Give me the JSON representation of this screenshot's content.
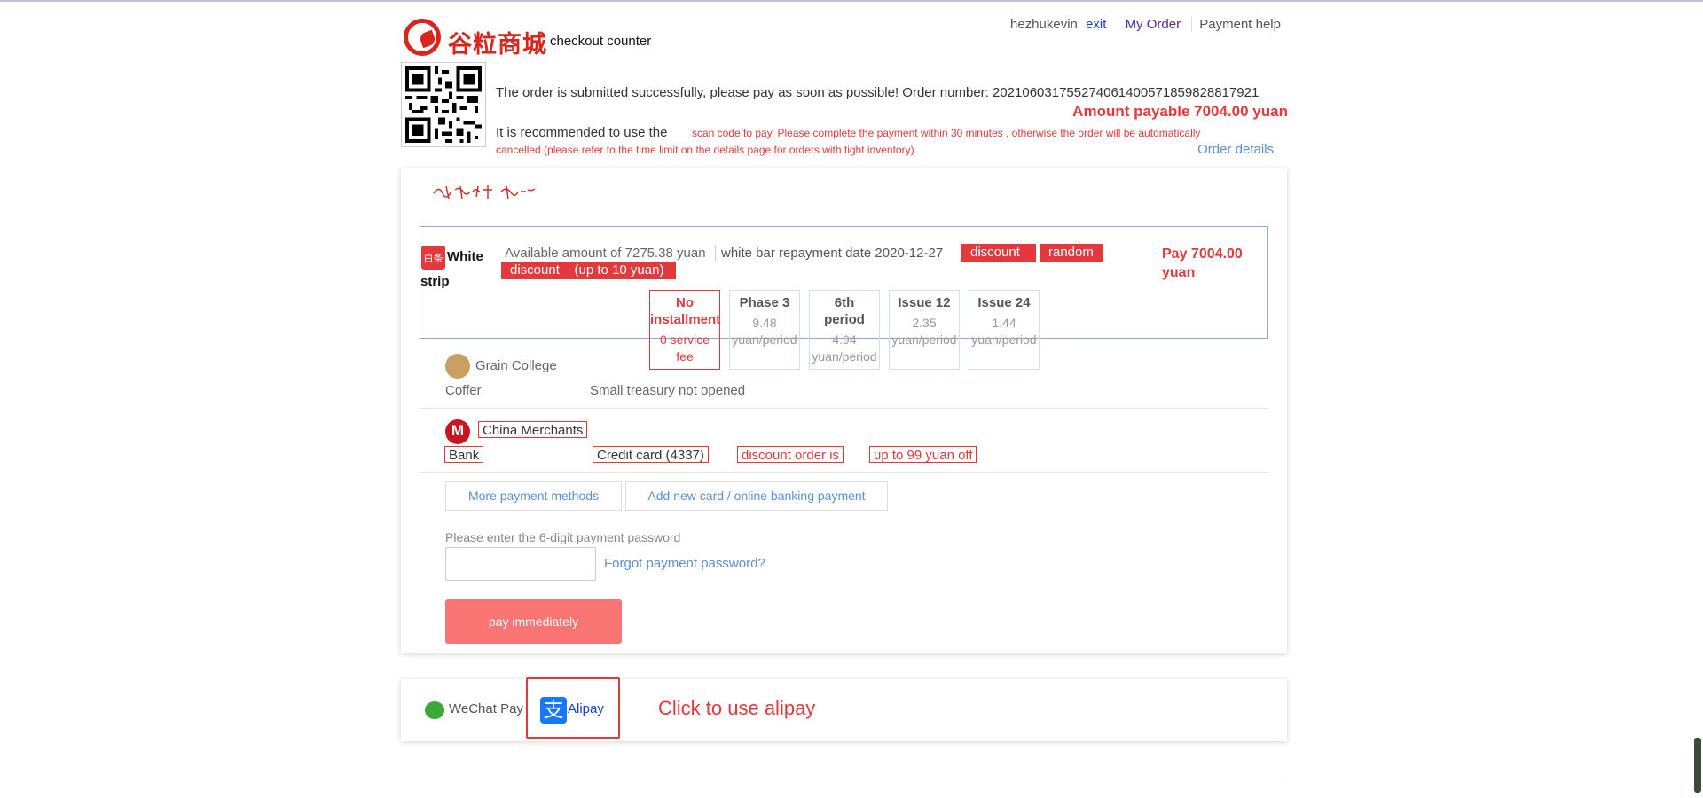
{
  "header": {
    "logo_cn": "谷粒商城",
    "logo_sub": "checkout counter",
    "username": "hezhukevin",
    "exit": "exit",
    "my_order": "My Order",
    "payment_help": "Payment help"
  },
  "order": {
    "submitted_text": "The order is submitted successfully, please pay as soon as possible! Order number: 202106031755274061400571859828817921",
    "amount_payable": "Amount payable 7004.00 yuan",
    "recommend_text": "It is recommended to use the",
    "scan_notice_1": "scan code to pay. Please complete the payment within 30 minutes , otherwise the order will be automatically",
    "scan_notice_2": "cancelled (please refer to the time limit on the details page for orders with tight inventory)",
    "order_details": "Order details"
  },
  "white_strip": {
    "icon_text": "白条",
    "label_1": "White",
    "label_2": "strip",
    "available": "Available amount of 7275.38 yuan",
    "repay_date": "white bar repayment date 2020-12-27",
    "tag_discount": "discount",
    "tag_random": "random",
    "tag_discount2": "discount    (up to 10 yuan)",
    "pay_1": "Pay 7004.00",
    "pay_2": "yuan",
    "plans": [
      {
        "title_1": "No",
        "title_2": "installment",
        "sub_1": "0 service",
        "sub_2": "fee",
        "selected": true
      },
      {
        "title_1": "Phase 3",
        "title_2": "",
        "sub_1": "9.48",
        "sub_2": "yuan/period",
        "selected": false
      },
      {
        "title_1": "6th",
        "title_2": "period",
        "sub_1": "4.94",
        "sub_2": "yuan/period",
        "selected": false
      },
      {
        "title_1": "Issue 12",
        "title_2": "",
        "sub_1": "2.35",
        "sub_2": "yuan/period",
        "selected": false
      },
      {
        "title_1": "Issue 24",
        "title_2": "",
        "sub_1": "1.44",
        "sub_2": "yuan/period",
        "selected": false
      }
    ]
  },
  "coffer": {
    "label_1": "Grain College",
    "label_2": "Coffer",
    "status": "Small treasury not opened"
  },
  "bank": {
    "name_1": "China Merchants",
    "name_2": "Bank",
    "card": "Credit card (4337)",
    "promo_1": "discount order is",
    "promo_2": "up to 99 yuan off"
  },
  "actions": {
    "more_methods": "More payment methods",
    "add_card": "Add new card / online banking payment",
    "pwd_label": "Please enter the 6-digit payment password",
    "forgot": "Forgot payment password?",
    "pay_now": "pay immediately"
  },
  "alt_pay": {
    "wechat": "WeChat Pay",
    "alipay": "Alipay",
    "alipay_icon": "支",
    "hint": "Click to use alipay"
  },
  "colors": {
    "accent_red": "#e4393c",
    "link_blue": "#5b8fd8",
    "pay_button": "#f97573"
  }
}
